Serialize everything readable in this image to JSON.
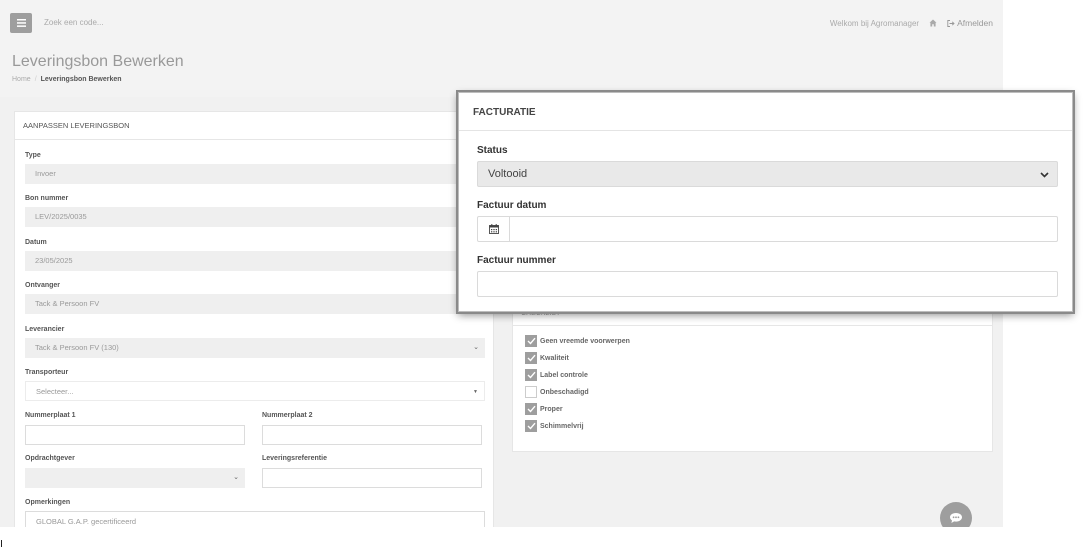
{
  "topbar": {
    "menu_icon": "hamburger-icon",
    "search_placeholder": "Zoek een code...",
    "welcome": "Welkom bij Agromanager",
    "home_icon": "home-icon",
    "logout_icon": "logout-icon",
    "logout_label": "Afmelden"
  },
  "page": {
    "title": "Leveringsbon Bewerken",
    "breadcrumb": {
      "home": "Home",
      "separator": "/",
      "current": "Leveringsbon Bewerken"
    }
  },
  "form": {
    "header": "AANPASSEN LEVERINGSBON",
    "type_label": "Type",
    "type_value": "Invoer",
    "bon_label": "Bon nummer",
    "bon_value": "LEV/2025/0035",
    "datum_label": "Datum",
    "datum_value": "23/05/2025",
    "ontvanger_label": "Ontvanger",
    "ontvanger_value": "Tack & Persoon FV",
    "leverancier_label": "Leverancier",
    "leverancier_value": "Tack & Persoon FV (130)",
    "transporteur_label": "Transporteur",
    "transporteur_placeholder": "Selecteer...",
    "nummerplaat1_label": "Nummerplaat 1",
    "nummerplaat1_value": "",
    "nummerplaat2_label": "Nummerplaat 2",
    "nummerplaat2_value": "",
    "opdrachtgever_label": "Opdrachtgever",
    "opdrachtgever_value": "",
    "leveringsreferentie_label": "Leveringsreferentie",
    "leveringsreferentie_value": "",
    "opmerkingen_label": "Opmerkingen",
    "opmerkingen_value": "GLOBAL G.A.P. gecertificeerd"
  },
  "checklist": {
    "header": "CHECKLIST",
    "items": [
      {
        "label": "Geen vreemde voorwerpen",
        "checked": true
      },
      {
        "label": "Kwaliteit",
        "checked": true
      },
      {
        "label": "Label controle",
        "checked": true
      },
      {
        "label": "Onbeschadigd",
        "checked": false
      },
      {
        "label": "Proper",
        "checked": true
      },
      {
        "label": "Schimmelvrij",
        "checked": true
      }
    ]
  },
  "facturatie": {
    "header": "FACTURATIE",
    "status_label": "Status",
    "status_value": "Voltooid",
    "datum_label": "Factuur datum",
    "datum_value": "",
    "calendar_icon": "calendar-icon",
    "nummer_label": "Factuur nummer",
    "nummer_value": ""
  },
  "chat": {
    "icon": "chat-bubble-icon"
  },
  "colors": {
    "background": "#f3f3f3",
    "accent_gray": "#9e9e9e",
    "field_fill": "#efefef"
  }
}
